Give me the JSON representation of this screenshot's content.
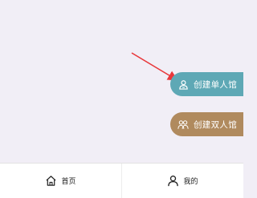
{
  "actions": {
    "create_single": {
      "label": "创建单人馆",
      "icon": "person-badge-icon",
      "color": "#5ea8b5"
    },
    "create_double": {
      "label": "创建双人馆",
      "icon": "two-people-icon",
      "color": "#b08a5e"
    }
  },
  "annotation": {
    "arrow_color": "#e8373a"
  },
  "tabbar": {
    "home_label": "首页",
    "home_icon": "home-icon",
    "mine_label": "我的",
    "mine_icon": "user-icon"
  },
  "theme": {
    "background": "#f1eef6"
  }
}
